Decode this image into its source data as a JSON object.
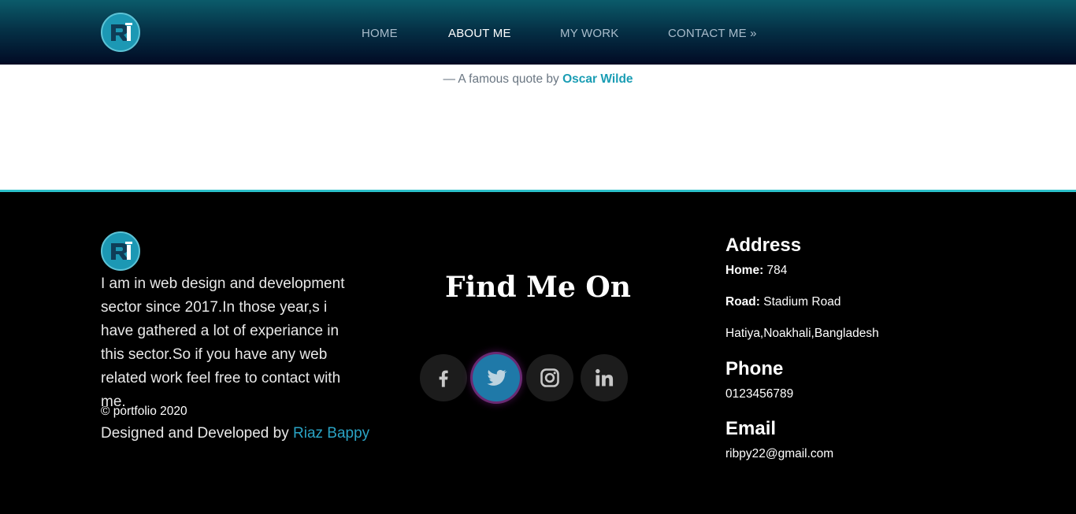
{
  "nav": {
    "items": [
      {
        "label": "HOME",
        "active": false
      },
      {
        "label": "ABOUT ME",
        "active": true
      },
      {
        "label": "MY WORK",
        "active": false
      },
      {
        "label": "CONTACT ME »",
        "active": false
      }
    ]
  },
  "quote": {
    "prefix": "— A famous quote by ",
    "author": "Oscar Wilde"
  },
  "footer": {
    "about": "I am in web design and development sector since 2017.In those year,s i have gathered a lot of experiance in this sector.So if you have any web related work feel free to contact with me.",
    "copyright": "© portfolio 2020",
    "credit_prefix": "Designed and Developed by ",
    "credit_name": "Riaz Bappy",
    "find_title": "Find Me On",
    "social": [
      {
        "icon": "facebook-icon",
        "active": false
      },
      {
        "icon": "twitter-icon",
        "active": true
      },
      {
        "icon": "instagram-icon",
        "active": false
      },
      {
        "icon": "linkedin-icon",
        "active": false
      }
    ],
    "address": {
      "heading": "Address",
      "home_label": "Home:",
      "home_value": " 784",
      "road_label": "Road:",
      "road_value": " Stadium Road",
      "city": "Hatiya,Noakhali,Bangladesh"
    },
    "phone": {
      "heading": "Phone",
      "value": "0123456789"
    },
    "email": {
      "heading": "Email",
      "value": "ribpy22@gmail.com"
    }
  },
  "colors": {
    "accent": "#1a9db4",
    "footer_bg": "#000000",
    "divider": "#2bc0c9",
    "twitter_active": "#1f79a8"
  }
}
